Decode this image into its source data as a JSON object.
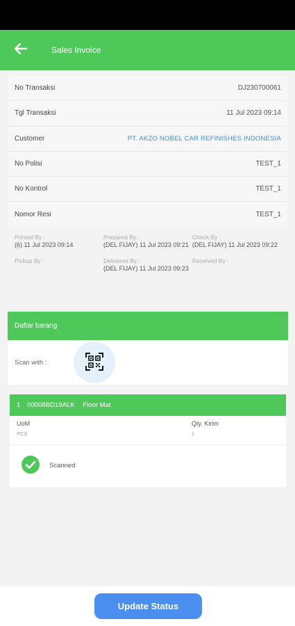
{
  "header": {
    "title": "Sales Invoice",
    "back_icon": "arrow-left-icon"
  },
  "colors": {
    "primary_green": "#4fc85a",
    "link_blue": "#3a8fd6",
    "button_blue": "#4a8ff0"
  },
  "details": [
    {
      "label": "No Transaksi",
      "value": "DJ230700061"
    },
    {
      "label": "Tgl Transaksi",
      "value": "11 Jul 2023 09:14"
    },
    {
      "label": "Customer",
      "value": "PT. AKZO NOBEL CAR REFINISHES INDONESIA"
    },
    {
      "label": "No Polisi",
      "value": "TEST_1"
    },
    {
      "label": "No Kontrol",
      "value": "TEST_1"
    },
    {
      "label": "Nomor Resi",
      "value": "TEST_1"
    }
  ],
  "meta": [
    {
      "label": "Printed By :",
      "value": "(6) 11 Jul 2023 09:14"
    },
    {
      "label": "Prepared By :",
      "value": "(DEL FIJAY) 11 Jul 2023 09:21"
    },
    {
      "label": "Check By :",
      "value": "(DEL FIJAY) 11 Jul 2023 09:22"
    },
    {
      "label": "Pickup By :",
      "value": ""
    },
    {
      "label": "Delivered By :",
      "value": "(DEL FIJAY) 11 Jul 2023 09:23"
    },
    {
      "label": "Received By :",
      "value": ""
    }
  ],
  "goods": {
    "section_title": "Daftar barang",
    "scan_label": "Scan with :",
    "scan_icon": "qr-scan-icon"
  },
  "item": {
    "number": "1",
    "code": "00008BD19ALK",
    "name": "Floor Mat",
    "uom_label": "UoM",
    "uom_value": "PCS",
    "qty_label": "Qty. Kirim",
    "qty_value": "1",
    "status": "Scanned",
    "status_icon": "check-circle-icon"
  },
  "footer": {
    "button_label": "Update Status"
  }
}
